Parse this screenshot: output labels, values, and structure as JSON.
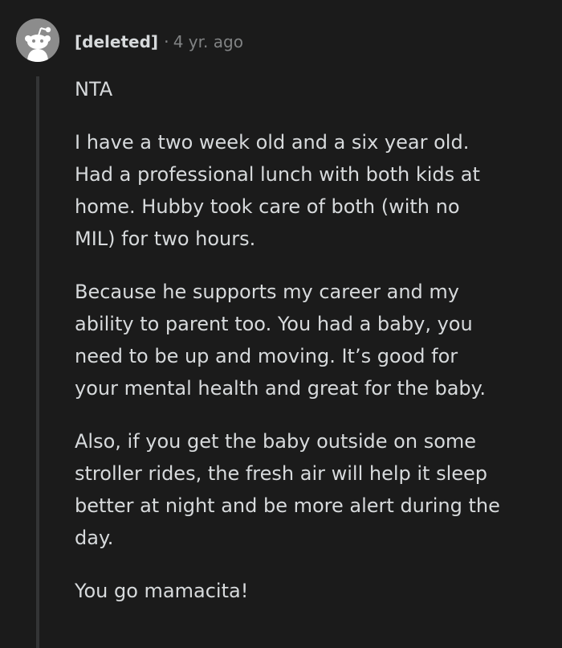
{
  "comment": {
    "author": "[deleted]",
    "separator": "·",
    "time": "4 yr. ago",
    "avatar_icon": "snoo-avatar-icon",
    "paragraphs": [
      [
        "NTA"
      ],
      [
        "I have a two week old and a six year old.",
        "Had a professional lunch with both kids at",
        "home. Hubby took care of both (with no",
        "MIL) for two hours."
      ],
      [
        "Because he supports my career and my",
        "ability to parent too. You had a baby, you",
        "need to be up and moving. It’s good for",
        "your mental health and great for the baby."
      ],
      [
        "Also, if you get the baby outside on some",
        "stroller rides, the fresh air will help it sleep",
        "better at night and be more alert during the",
        "day."
      ],
      [
        "You go mamacita!"
      ]
    ]
  },
  "colors": {
    "background": "#1b1b1b",
    "text": "#d7dadc",
    "meta": "#818384",
    "thread_line": "#343536",
    "avatar_bg": "#8c8c8c"
  }
}
